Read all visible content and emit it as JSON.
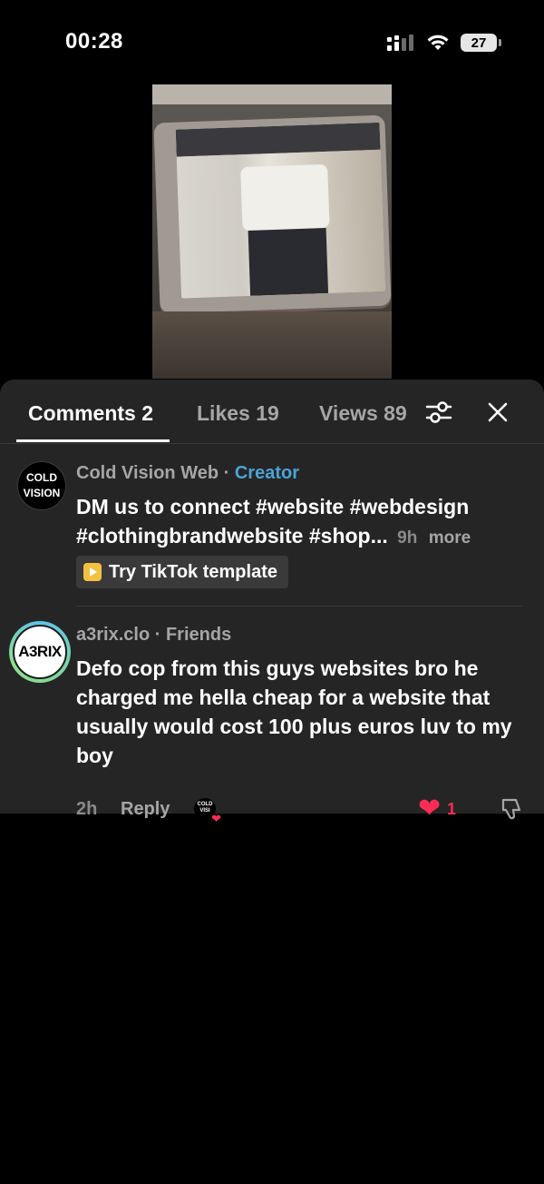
{
  "status_bar": {
    "time": "00:28",
    "battery": "27"
  },
  "tabs": {
    "comments": "Comments 2",
    "likes": "Likes 19",
    "views": "Views 89"
  },
  "comments": [
    {
      "avatar_text": [
        "COLD",
        "VISION"
      ],
      "author": "Cold Vision Web",
      "separator": " · ",
      "tag": "Creator",
      "text": "DM us to connect #website #webdesign #clothingbrandwebsite #shop...",
      "time": "9h",
      "more_label": "more",
      "template_label": "Try TikTok template"
    },
    {
      "avatar_text": "A3RIX",
      "author": "a3rix.clo",
      "separator": " · ",
      "tag": "Friends",
      "text": "Defo cop from this guys websites bro he charged me hella cheap for a website that usually would cost 100 plus euros luv to my boy",
      "time": "2h",
      "reply_label": "Reply",
      "creator_liked_text": "COLD VISI",
      "like_count": "1"
    }
  ],
  "colors": {
    "sheet_bg": "#252525",
    "creator_tag": "#4ba4d6",
    "like_red": "#fe2c55"
  }
}
